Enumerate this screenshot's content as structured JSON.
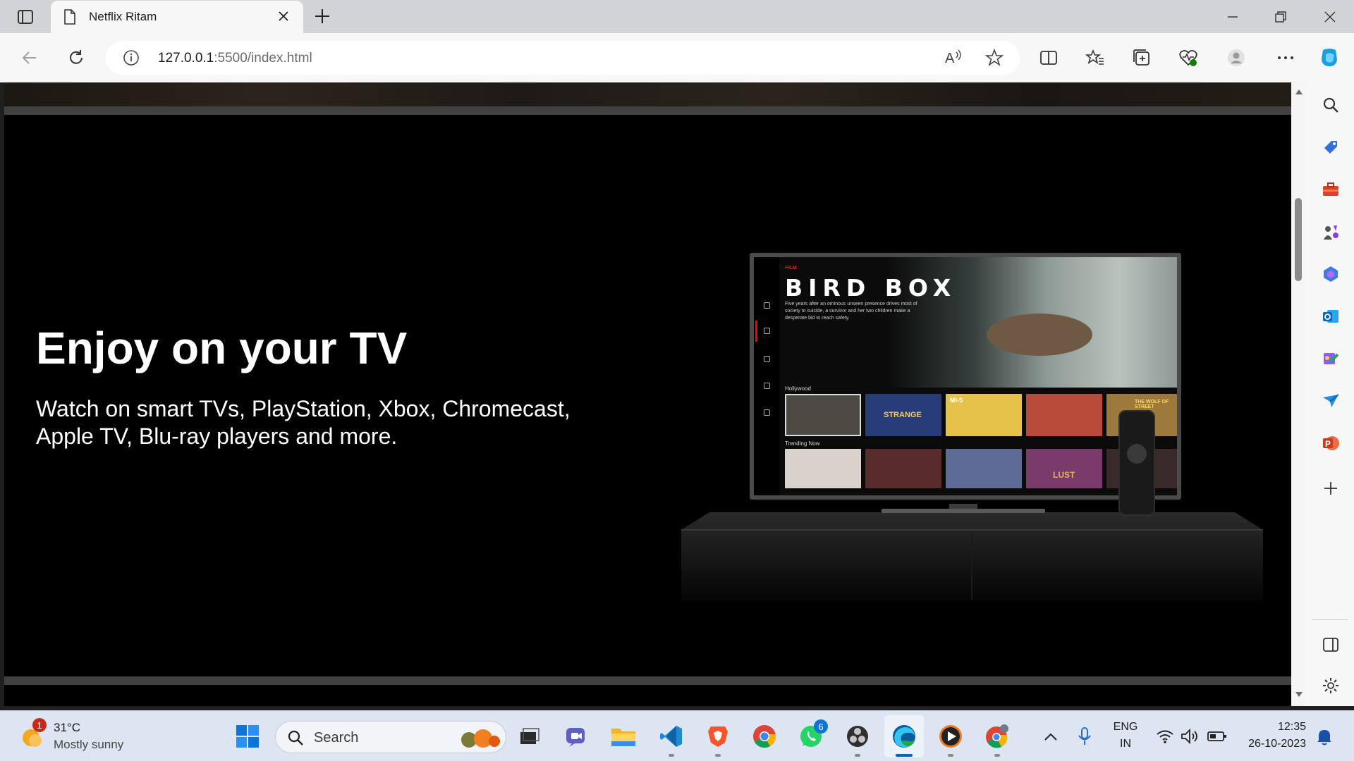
{
  "browser": {
    "tab_title": "Netflix Ritam",
    "url_host": "127.0.0.1",
    "url_rest": ":5500/index.html"
  },
  "page": {
    "headline": "Enjoy on your TV",
    "subtext": "Watch on smart TVs, PlayStation, Xbox, Chromecast, Apple TV, Blu-ray players and more.",
    "tv_screen": {
      "brand_tag": "FILM",
      "title": "BIRD BOX",
      "description": "Five years after an ominous unseen presence drives most of society to suicide, a survivor and her two children make a desperate bid to reach safety.",
      "row1_label": "Hollywood",
      "row2_label": "Trending Now",
      "thumb_strange": "STRANGE",
      "thumb_mi": "MI-5",
      "thumb_wolf": "THE WOLF OF STREET",
      "thumb_lust": "LUST"
    }
  },
  "taskbar": {
    "weather_temp": "31°C",
    "weather_desc": "Mostly sunny",
    "weather_badge": "1",
    "search_label": "Search",
    "whatsapp_badge": "6",
    "lang_top": "ENG",
    "lang_bottom": "IN",
    "time": "12:35",
    "date": "26-10-2023"
  },
  "colors": {
    "accent_edge": "#0067c0",
    "netflix_red": "#e50914"
  }
}
